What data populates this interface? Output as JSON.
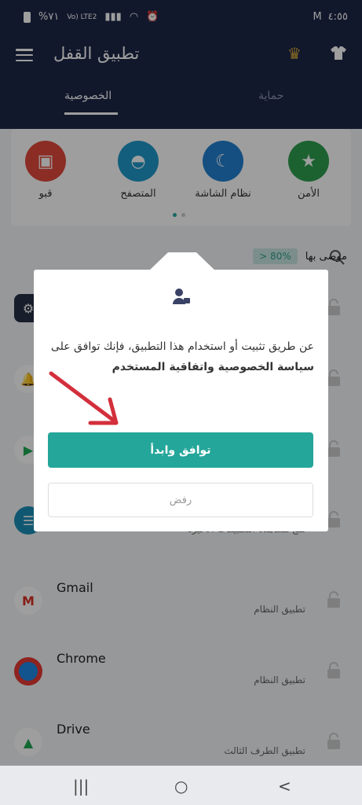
{
  "status_bar": {
    "battery_text": "%٧١",
    "network": "Vo) LTE2",
    "time": "٤:٥٥"
  },
  "app": {
    "title": "تطبيق القفل"
  },
  "tabs": [
    {
      "label": "الخصوصية"
    },
    {
      "label": "حماية"
    }
  ],
  "features": [
    {
      "label": "الأمن",
      "color": "#2e9f4f",
      "icon": "shield-star-icon"
    },
    {
      "label": "نظام الشاشة",
      "color": "#2380d0",
      "icon": "moon-icon"
    },
    {
      "label": "المتصفح",
      "color": "#1f98c9",
      "icon": "mask-icon"
    },
    {
      "label": "قبو",
      "color": "#e04a3c",
      "icon": "vault-icon"
    }
  ],
  "recommend": {
    "label": "موصى بها",
    "badge": "> 80%"
  },
  "apps": [
    {
      "name": "",
      "sub": ""
    },
    {
      "name": "",
      "sub": ""
    },
    {
      "name": "",
      "sub": ""
    },
    {
      "name": "",
      "sub": "منع مشاهدة التطبيقات الأخيرة"
    },
    {
      "name": "Gmail",
      "sub": "تطبيق النظام"
    },
    {
      "name": "Chrome",
      "sub": "تطبيق النظام"
    },
    {
      "name": "Drive",
      "sub": "تطبيق الطرف الثالث"
    }
  ],
  "dialog": {
    "text_before": "عن طريق تثبيت أو استخدام هذا التطبيق، فإنك توافق على ",
    "link_text": "سياسة الخصوصية واتفاقية المستخدم",
    "primary_button": "توافق وابدأ",
    "secondary_button": "رفض"
  },
  "navbar": {
    "recent": "|||",
    "home": "○",
    "back": "<"
  },
  "colors": {
    "header": "#1e2747",
    "accent": "#25a69a",
    "arrow": "#d32f3c"
  }
}
